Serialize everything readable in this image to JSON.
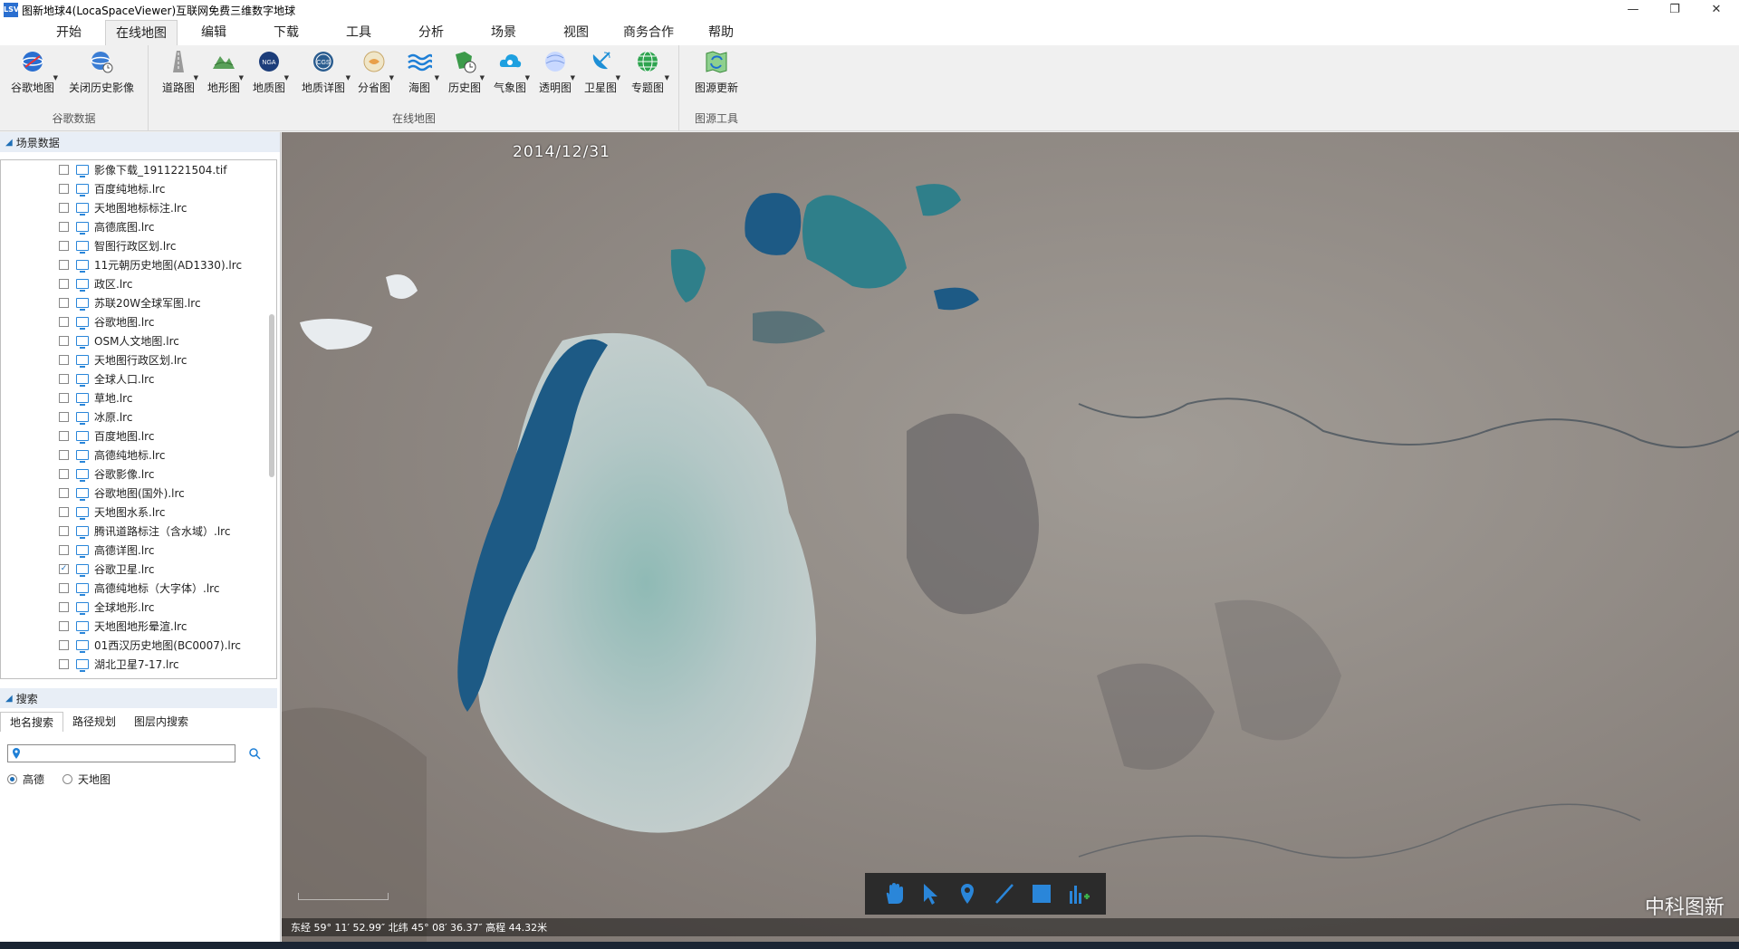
{
  "window": {
    "icon_text": "LSV",
    "title": "图新地球4(LocaSpaceViewer)互联网免费三维数字地球",
    "controls": [
      "—",
      "❐",
      "✕"
    ]
  },
  "menu": [
    "开始",
    "在线地图",
    "编辑",
    "下载",
    "工具",
    "分析",
    "场景",
    "视图",
    "商务合作",
    "帮助"
  ],
  "menu_active": "在线地图",
  "ribbon": {
    "google_group": {
      "label": "谷歌数据",
      "buttons": [
        {
          "label": "谷歌地图",
          "icon": "google-globe-icon"
        },
        {
          "label": "关闭历史影像",
          "icon": "history-globe-icon"
        }
      ]
    },
    "online_group": {
      "label": "在线地图",
      "buttons": [
        {
          "label": "道路图",
          "icon": "road-icon"
        },
        {
          "label": "地形图",
          "icon": "terrain-icon"
        },
        {
          "label": "地质图",
          "icon": "nga-icon"
        },
        {
          "label": "地质详图",
          "icon": "cgs-icon"
        },
        {
          "label": "分省图",
          "icon": "province-icon"
        },
        {
          "label": "海图",
          "icon": "sea-icon"
        },
        {
          "label": "历史图",
          "icon": "history-map-icon"
        },
        {
          "label": "气象图",
          "icon": "weather-icon"
        },
        {
          "label": "透明图",
          "icon": "transparent-icon"
        },
        {
          "label": "卫星图",
          "icon": "satellite-icon"
        },
        {
          "label": "专题图",
          "icon": "thematic-icon"
        }
      ]
    },
    "tools_group": {
      "label": "图源工具",
      "buttons": [
        {
          "label": "图源更新",
          "icon": "source-update-icon"
        }
      ]
    }
  },
  "scene_panel": {
    "title": "场景数据",
    "layers": [
      {
        "name": "影像下载_1911221504.tif",
        "checked": false
      },
      {
        "name": "百度纯地标.lrc",
        "checked": false
      },
      {
        "name": "天地图地标标注.lrc",
        "checked": false
      },
      {
        "name": "高德底图.lrc",
        "checked": false
      },
      {
        "name": "智图行政区划.lrc",
        "checked": false
      },
      {
        "name": "11元朝历史地图(AD1330).lrc",
        "checked": false
      },
      {
        "name": "政区.lrc",
        "checked": false
      },
      {
        "name": "苏联20W全球军图.lrc",
        "checked": false
      },
      {
        "name": "谷歌地图.lrc",
        "checked": false
      },
      {
        "name": "OSM人文地图.lrc",
        "checked": false
      },
      {
        "name": "天地图行政区划.lrc",
        "checked": false
      },
      {
        "name": "全球人口.lrc",
        "checked": false
      },
      {
        "name": "草地.lrc",
        "checked": false
      },
      {
        "name": "冰原.lrc",
        "checked": false
      },
      {
        "name": "百度地图.lrc",
        "checked": false
      },
      {
        "name": "高德纯地标.lrc",
        "checked": false
      },
      {
        "name": "谷歌影像.lrc",
        "checked": false
      },
      {
        "name": "谷歌地图(国外).lrc",
        "checked": false
      },
      {
        "name": "天地图水系.lrc",
        "checked": false
      },
      {
        "name": "腾讯道路标注（含水域）.lrc",
        "checked": false
      },
      {
        "name": "高德详图.lrc",
        "checked": false
      },
      {
        "name": "谷歌卫星.lrc",
        "checked": true
      },
      {
        "name": "高德纯地标（大字体）.lrc",
        "checked": false
      },
      {
        "name": "全球地形.lrc",
        "checked": false
      },
      {
        "name": "天地图地形晕渲.lrc",
        "checked": false
      },
      {
        "name": "01西汉历史地图(BC0007).lrc",
        "checked": false
      },
      {
        "name": "湖北卫星7-17.lrc",
        "checked": false
      }
    ]
  },
  "search_panel": {
    "title": "搜索",
    "tabs": [
      "地名搜索",
      "路径规划",
      "图层内搜索"
    ],
    "active_tab": "地名搜索",
    "input_value": "",
    "sources": [
      {
        "label": "高德",
        "selected": true
      },
      {
        "label": "天地图",
        "selected": false
      }
    ]
  },
  "map": {
    "date": "2014/12/31",
    "watermark": "中科图新",
    "status_left": "东经 59° 11′ 52.99″  北纬 45° 08′ 36.37″  高程 44.32米",
    "tools": [
      "pan-hand-icon",
      "select-arrow-icon",
      "placemark-icon",
      "line-draw-icon",
      "polygon-draw-icon",
      "chart-add-icon"
    ],
    "colors": {
      "deep_water": "#1d5a85",
      "teal_water": "#2f7f8a",
      "salt_flat": "#b8c6c4",
      "land": "#8c8782"
    }
  }
}
